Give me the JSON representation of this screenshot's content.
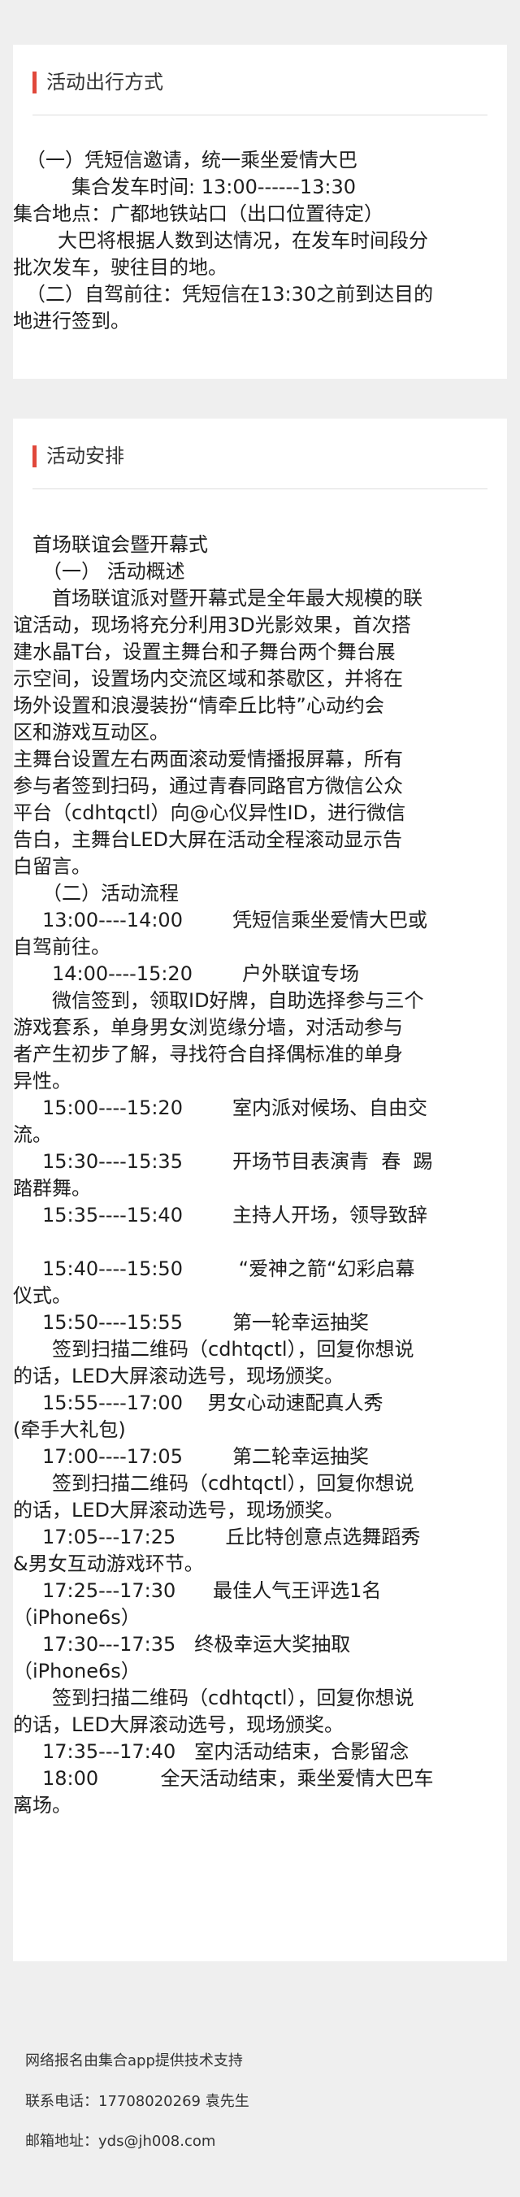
{
  "section_travel": {
    "title": "活动出行方式",
    "lines": [
      "（一）凭短信邀请，统一乘坐爱情大巴",
      "集合发车时间: 13:00------13:30",
      "集合地点：广都地铁站口（出口位置待定）",
      "大巴将根据人数到达情况，在发车时间段分",
      "批次发车，驶往目的地。",
      "（二）自驾前往：凭短信在13:30之前到达目的",
      "地进行签到。"
    ]
  },
  "section_schedule": {
    "title": "活动安排",
    "lines": [
      "首场联谊会暨开幕式",
      "（一） 活动概述",
      "首场联谊派对暨开幕式是全年最大规模的联",
      "谊活动，现场将充分利用3D光影效果，首次搭",
      "建水晶T台，设置主舞台和子舞台两个舞台展",
      "示空间，设置场内交流区域和茶歇区，并将在",
      "场外设置和浪漫装扮“情牵丘比特”心动约会",
      "区和游戏互动区。",
      "主舞台设置左右两面滚动爱情播报屏幕，所有",
      "参与者签到扫码，通过青春同路官方微信公众",
      "平台（cdhtqctl）向@心仪异性ID，进行微信",
      "告白，主舞台LED大屏在活动全程滚动显示告",
      "白留言。",
      "（二）活动流程",
      "13:00----14:00        凭短信乘坐爱情大巴或",
      "自驾前往。",
      "14:00----15:20        户外联谊专场",
      "微信签到，领取ID好牌，自助选择参与三个",
      "游戏套系，单身男女浏览缘分墙，对活动参与",
      "者产生初步了解，寻找符合自择偶标准的单身",
      "异性。",
      "15:00----15:20        室内派对候场、自由交",
      "流。",
      "15:30----15:35        开场节目表演青  春  踢",
      "踏群舞。",
      "15:35----15:40        主持人开场，领导致辞",
      "15:40----15:50         “爱神之箭“幻彩启幕",
      "仪式。",
      "15:50----15:55        第一轮幸运抽奖",
      "签到扫描二维码（cdhtqctl），回复你想说",
      "的话，LED大屏滚动选号，现场颁奖。",
      "15:55----17:00    男女心动速配真人秀",
      "(牵手大礼包)",
      "17:00----17:05        第二轮幸运抽奖",
      "签到扫描二维码（cdhtqctl），回复你想说",
      "的话，LED大屏滚动选号，现场颁奖。",
      "17:05---17:25        丘比特创意点选舞蹈秀",
      "&男女互动游戏环节。",
      "17:25---17:30      最佳人气王评选1名",
      "（iPhone6s）",
      "17:30---17:35   终极幸运大奖抽取",
      "（iPhone6s）",
      "签到扫描二维码（cdhtqctl），回复你想说",
      "的话，LED大屏滚动选号，现场颁奖。",
      "17:35---17:40   室内活动结束，合影留念",
      "18:00          全天活动结束，乘坐爱情大巴车",
      "离场。"
    ]
  },
  "footer": {
    "support": "网络报名由集合app提供技术支持",
    "phone": "联系电话：17708020269 袁先生",
    "email": "邮箱地址：yds@jh008.com"
  },
  "colors": {
    "accent": "#e0483b",
    "page_background": "#efefef",
    "card_background": "#ffffff"
  }
}
